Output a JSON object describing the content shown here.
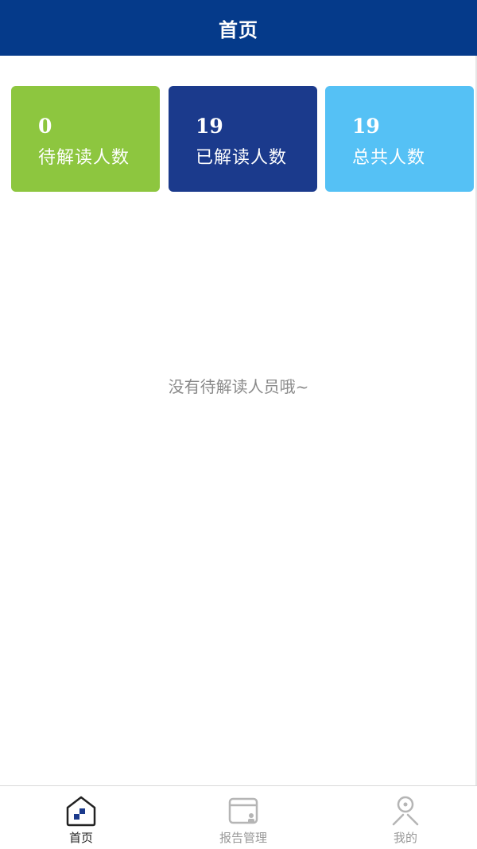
{
  "header": {
    "title": "首页"
  },
  "stats": [
    {
      "value": "0",
      "label": "待解读人数",
      "color": "#8dc63f"
    },
    {
      "value": "19",
      "label": "已解读人数",
      "color": "#1b3a8c"
    },
    {
      "value": "19",
      "label": "总共人数",
      "color": "#55c1f5"
    }
  ],
  "empty_message": "没有待解读人员哦~",
  "tabbar": {
    "items": [
      {
        "label": "首页",
        "icon": "home-icon",
        "active": true
      },
      {
        "label": "报告管理",
        "icon": "report-icon",
        "active": false
      },
      {
        "label": "我的",
        "icon": "user-icon",
        "active": false
      }
    ]
  },
  "colors": {
    "header_bg": "#053a8a",
    "active_icon": "#1b3a8c",
    "inactive_icon": "#b5b5b5"
  }
}
